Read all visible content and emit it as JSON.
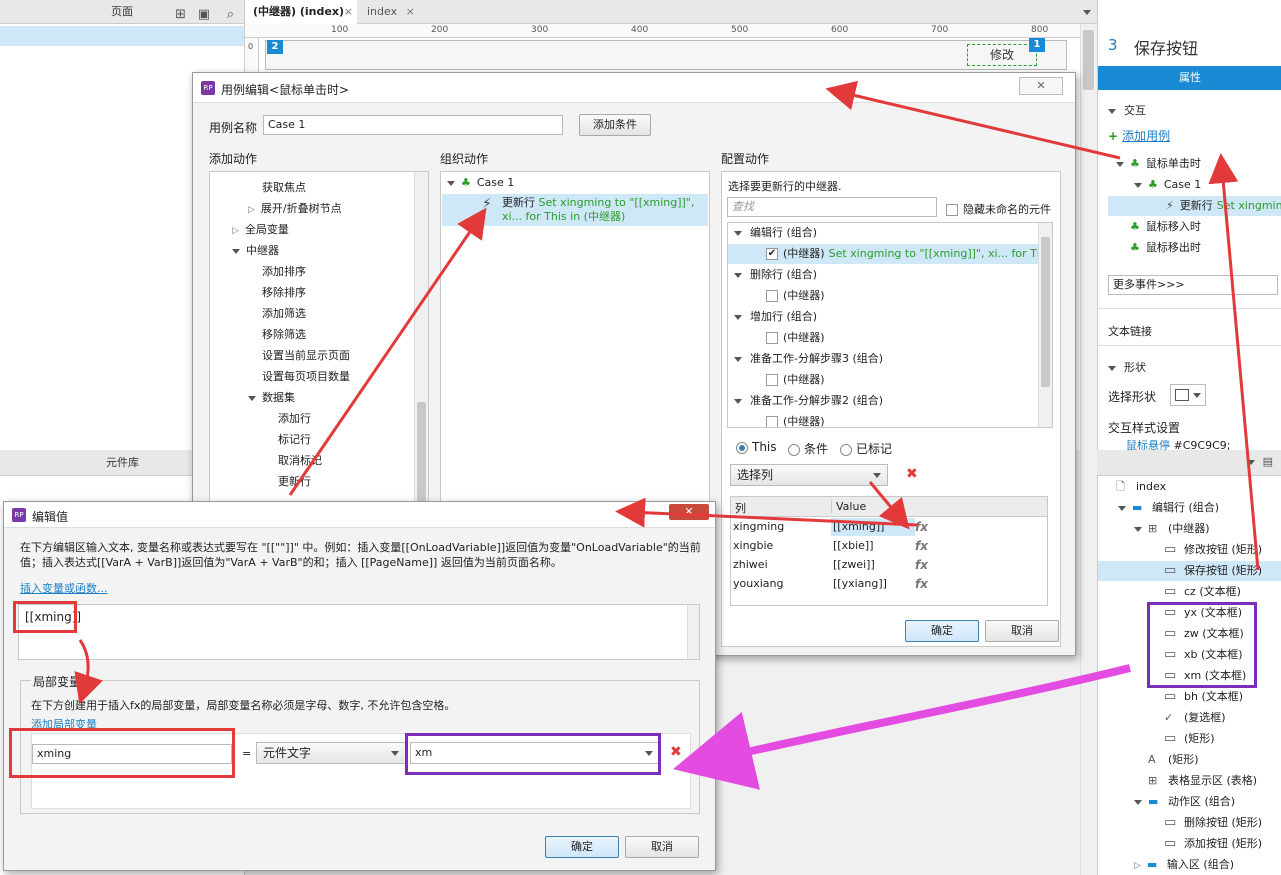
{
  "left_panel": {
    "pages_header": "页面",
    "widgets_header": "元件库"
  },
  "tabs": [
    {
      "label": "(中继器) (index)",
      "active": true
    },
    {
      "label": "index",
      "active": false
    }
  ],
  "ruler": {
    "ticks": [
      "100",
      "200",
      "300",
      "400",
      "500",
      "600",
      "700",
      "800"
    ]
  },
  "canvas": {
    "badge_left": "2",
    "badge_right": "1",
    "edit_button": "修改",
    "left_mark": "0"
  },
  "case_editor": {
    "title": "用例编辑<鼠标单击时>",
    "case_name_label": "用例名称",
    "case_name_value": "Case 1",
    "add_condition": "添加条件",
    "add_action_title": "添加动作",
    "organize_title": "组织动作",
    "configure_title": "配置动作",
    "action_tree": [
      {
        "label": "获取焦点",
        "indent": 2,
        "toggle": ""
      },
      {
        "label": "展开/折叠树节点",
        "indent": 2,
        "toggle": "right"
      },
      {
        "label": "全局变量",
        "indent": 1,
        "toggle": "right"
      },
      {
        "label": "中继器",
        "indent": 1,
        "toggle": "down"
      },
      {
        "label": "添加排序",
        "indent": 2,
        "toggle": ""
      },
      {
        "label": "移除排序",
        "indent": 2,
        "toggle": ""
      },
      {
        "label": "添加筛选",
        "indent": 2,
        "toggle": ""
      },
      {
        "label": "移除筛选",
        "indent": 2,
        "toggle": ""
      },
      {
        "label": "设置当前显示页面",
        "indent": 2,
        "toggle": ""
      },
      {
        "label": "设置每页项目数量",
        "indent": 2,
        "toggle": ""
      },
      {
        "label": "数据集",
        "indent": 2,
        "toggle": "down"
      },
      {
        "label": "添加行",
        "indent": 3,
        "toggle": ""
      },
      {
        "label": "标记行",
        "indent": 3,
        "toggle": ""
      },
      {
        "label": "取消标记",
        "indent": 3,
        "toggle": ""
      },
      {
        "label": "更新行",
        "indent": 3,
        "toggle": ""
      }
    ],
    "organize_case": "Case 1",
    "organize_action_label": "更新行",
    "organize_action_detail": "Set xingming to \"[[xming]]\", xi... for This in (中继器)",
    "configure_prompt": "选择要更新行的中继器.",
    "search_placeholder": "查找",
    "hide_unnamed": "隐藏未命名的元件",
    "targets": [
      {
        "label": "编辑行 (组合)",
        "group": true
      },
      {
        "label": "(中继器)",
        "detail": "Set xingming to \"[[xming]]\", xi... for This",
        "checked": true
      },
      {
        "label": "删除行 (组合)",
        "group": true
      },
      {
        "label": "(中继器)",
        "checked": false
      },
      {
        "label": "增加行 (组合)",
        "group": true
      },
      {
        "label": "(中继器)",
        "checked": false
      },
      {
        "label": "准备工作-分解步骤3 (组合)",
        "group": true
      },
      {
        "label": "(中继器)",
        "checked": false
      },
      {
        "label": "准备工作-分解步骤2 (组合)",
        "group": true
      },
      {
        "label": "(中继器)",
        "checked": false
      }
    ],
    "radio_options": [
      "This",
      "条件",
      "已标记"
    ],
    "select_column": "选择列",
    "col_header": "列",
    "value_header": "Value",
    "rows": [
      {
        "col": "xingming",
        "value": "[[xming]]"
      },
      {
        "col": "xingbie",
        "value": "[[xbie]]"
      },
      {
        "col": "zhiwei",
        "value": "[[zwei]]"
      },
      {
        "col": "youxiang",
        "value": "[[yxiang]]"
      }
    ],
    "fx": "fx",
    "ok": "确定",
    "cancel": "取消"
  },
  "edit_value": {
    "title": "编辑值",
    "description": "在下方编辑区输入文本, 变量名称或表达式要写在 \"[[\"\"]]\" 中。例如：插入变量[[OnLoadVariable]]返回值为变量\"OnLoadVariable\"的当前值；插入表达式[[VarA + VarB]]返回值为\"VarA + VarB\"的和；插入 [[PageName]] 返回值为当前页面名称。",
    "insert_link": "插入变量或函数...",
    "expression": "[[xming]]",
    "local_vars_title": "局部变量",
    "local_vars_desc": "在下方创建用于插入fx的局部变量，局部变量名称必须是字母、数字, 不允许包含空格。",
    "add_local_var": "添加局部变量",
    "var_name": "xming",
    "equals": "=",
    "var_type": "元件文字",
    "var_target": "xm",
    "ok": "确定",
    "cancel": "取消"
  },
  "right_panel": {
    "widget_number": "3",
    "widget_name": "保存按钮",
    "properties_tab": "属性",
    "interactions_label": "交互",
    "add_case": "添加用例",
    "events": [
      {
        "label": "鼠标单击时",
        "indent": 1,
        "toggle": "down",
        "icon": "event"
      },
      {
        "label": "Case 1",
        "indent": 2,
        "toggle": "down",
        "icon": "case"
      },
      {
        "label": "更新行",
        "detail": "Set xingming",
        "indent": 3,
        "toggle": "",
        "icon": "action",
        "selected": true
      },
      {
        "label": "鼠标移入时",
        "indent": 1,
        "toggle": "",
        "icon": "event"
      },
      {
        "label": "鼠标移出时",
        "indent": 1,
        "toggle": "",
        "icon": "event"
      }
    ],
    "more_events": "更多事件>>>",
    "text_link": "文本链接",
    "shape_section": "形状",
    "select_shape": "选择形状",
    "interaction_style": "交互样式设置",
    "hover_label": "鼠标悬停",
    "hover_value": "#C9C9C9;"
  },
  "outline": {
    "items": [
      {
        "label": "index",
        "indent": 0,
        "icon": "page",
        "toggle": ""
      },
      {
        "label": "编辑行 (组合)",
        "indent": 1,
        "icon": "folder",
        "toggle": "down"
      },
      {
        "label": "(中继器)",
        "indent": 2,
        "icon": "grid",
        "toggle": "down"
      },
      {
        "label": "修改按钮 (矩形)",
        "indent": 3,
        "icon": "rect",
        "toggle": ""
      },
      {
        "label": "保存按钮 (矩形)",
        "indent": 3,
        "icon": "rect",
        "toggle": "",
        "selected": true
      },
      {
        "label": "cz (文本框)",
        "indent": 3,
        "icon": "textbox",
        "toggle": ""
      },
      {
        "label": "yx (文本框)",
        "indent": 3,
        "icon": "textbox",
        "toggle": ""
      },
      {
        "label": "zw (文本框)",
        "indent": 3,
        "icon": "textbox",
        "toggle": ""
      },
      {
        "label": "xb (文本框)",
        "indent": 3,
        "icon": "textbox",
        "toggle": ""
      },
      {
        "label": "xm (文本框)",
        "indent": 3,
        "icon": "textbox",
        "toggle": ""
      },
      {
        "label": "bh (文本框)",
        "indent": 3,
        "icon": "textbox",
        "toggle": ""
      },
      {
        "label": "(复选框)",
        "indent": 3,
        "icon": "check",
        "toggle": ""
      },
      {
        "label": "(矩形)",
        "indent": 3,
        "icon": "rect",
        "toggle": ""
      },
      {
        "label": "(矩形)",
        "indent": 2,
        "icon": "text",
        "toggle": ""
      },
      {
        "label": "表格显示区 (表格)",
        "indent": 2,
        "icon": "grid",
        "toggle": ""
      },
      {
        "label": "动作区 (组合)",
        "indent": 2,
        "icon": "folder",
        "toggle": "down"
      },
      {
        "label": "删除按钮 (矩形)",
        "indent": 3,
        "icon": "rect",
        "toggle": ""
      },
      {
        "label": "添加按钮 (矩形)",
        "indent": 3,
        "icon": "rect",
        "toggle": ""
      },
      {
        "label": "输入区 (组合)",
        "indent": 2,
        "icon": "folder",
        "toggle": "right"
      }
    ]
  },
  "colors": {
    "accent": "#1c7fc4",
    "annotation_red": "#e23a3a",
    "annotation_purple": "#7a2fb8",
    "annotation_magenta": "#e44be0",
    "selected_bg": "#cfe8f8",
    "blue_tab": "#1a8ad4"
  }
}
